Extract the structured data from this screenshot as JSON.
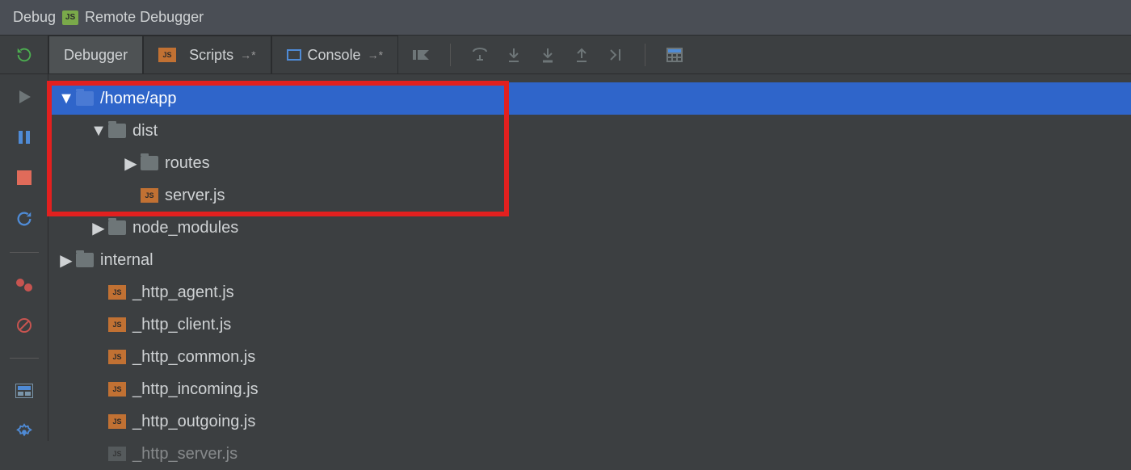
{
  "window": {
    "title": "Debug",
    "config_name": "Remote Debugger"
  },
  "tabs": {
    "debugger": "Debugger",
    "scripts": "Scripts",
    "console": "Console"
  },
  "tree": {
    "root": "/home/app",
    "dist": "dist",
    "routes": "routes",
    "server_js": "server.js",
    "node_modules": "node_modules",
    "internal": "internal",
    "files": {
      "http_agent": "_http_agent.js",
      "http_client": "_http_client.js",
      "http_common": "_http_common.js",
      "http_incoming": "_http_incoming.js",
      "http_outgoing": "_http_outgoing.js",
      "http_server": "_http_server.js"
    }
  },
  "colors": {
    "selection": "#2f65ca",
    "highlight_border": "#e2201f",
    "js_badge": "#c17133"
  }
}
